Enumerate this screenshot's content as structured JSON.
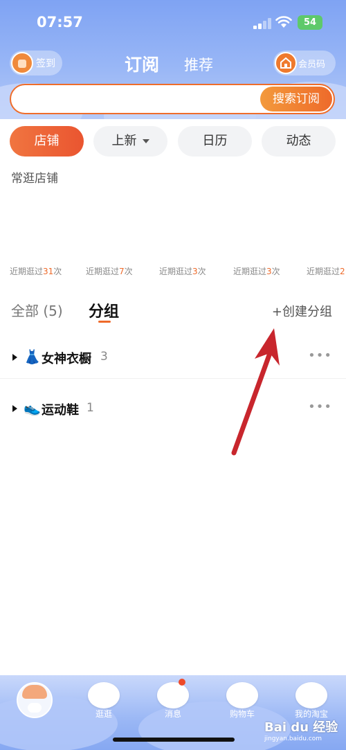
{
  "status_bar": {
    "time": "07:57",
    "battery": "54"
  },
  "header": {
    "sign_label": "签到",
    "tab_active": "订阅",
    "tab_recommend": "推荐",
    "member_label": "会员码",
    "search_placeholder": "",
    "search_button": "搜索订阅"
  },
  "filters": [
    {
      "label": "店铺"
    },
    {
      "label": "上新"
    },
    {
      "label": "日历"
    },
    {
      "label": "动态"
    }
  ],
  "section_title": "常逛店铺",
  "recent_visits": [
    {
      "prefix": "近期逛过",
      "count": "31",
      "suffix": "次"
    },
    {
      "prefix": "近期逛过",
      "count": "7",
      "suffix": "次"
    },
    {
      "prefix": "近期逛过",
      "count": "3",
      "suffix": "次"
    },
    {
      "prefix": "近期逛过",
      "count": "3",
      "suffix": "次"
    },
    {
      "prefix": "近期逛过",
      "count": "2",
      "suffix": ""
    }
  ],
  "group_tabs": {
    "all_label": "全部 (5)",
    "group_label": "分组",
    "create_label": "+创建分组"
  },
  "groups": [
    {
      "emoji": "👗",
      "name": "女神衣橱",
      "count": "3",
      "more": "•••"
    },
    {
      "emoji": "👟",
      "name": "运动鞋",
      "count": "1",
      "more": "•••"
    }
  ],
  "tabbar": {
    "tab1": "逛逛",
    "tab2": "消息",
    "tab3": "购物车",
    "tab4": "我的淘宝"
  },
  "watermark": {
    "logo": "Bai du 经验",
    "url": "jingyan.baidu.com"
  },
  "colors": {
    "accent": "#ee6a2a",
    "header_blue": "#8fb0f5",
    "annotation_red": "#c8262d"
  }
}
